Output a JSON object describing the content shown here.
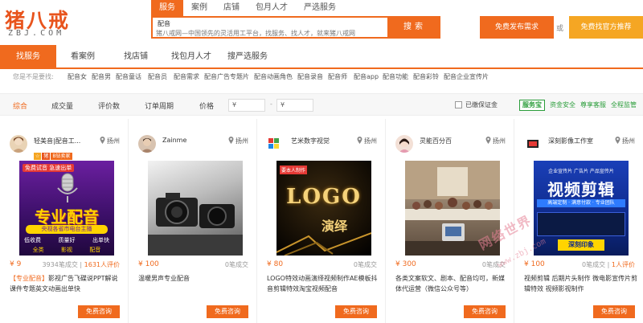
{
  "logo": {
    "cn": "猪八戒",
    "en": "ZBJ.COM"
  },
  "search": {
    "tabs": [
      "服务",
      "案例",
      "店铺",
      "包月人才",
      "严选服务"
    ],
    "query": "配音",
    "suggest": "猪八戒网—中国领先的灵活用工平台，找服务、找人才，就来猪八戒网",
    "button": "搜索"
  },
  "header_buttons": {
    "post": "免费发布需求",
    "or": "或",
    "find": "免费找官方推荐"
  },
  "nav": [
    "找服务",
    "看案例",
    "找店铺",
    "找包月人才",
    "搜严选服务"
  ],
  "related": {
    "label": "您是不是要找:",
    "items": [
      "配音女",
      "配音男",
      "配音童话",
      "配音员",
      "配音需求",
      "配音广告专题片",
      "配音动画角色",
      "配音录音",
      "配音师",
      "配音app",
      "配音功能",
      "配音彩铃",
      "配音企业宣传片"
    ]
  },
  "sortbar": {
    "items": [
      "综合",
      "成交量",
      "评价数",
      "订单周期",
      "价格"
    ],
    "price_from": "¥",
    "price_to": "¥",
    "dash": "-",
    "guarantee": "已缴保证金",
    "svc_logo": "服务宝",
    "svc_items": [
      "资金安全",
      "尊享客服",
      "全程监管"
    ]
  },
  "cards": [
    {
      "name": "轻美音|配音工...",
      "location": "扬州",
      "badges": [
        "☆",
        "猪",
        "B钻卖家"
      ],
      "price": "¥ 9",
      "stats_a": "3934笔成交",
      "stats_b": "1631人评价",
      "title_hl": "【专业配音】",
      "title": "影视广告飞碟说PPT解说课件专题英文动画出单快",
      "button": "免费咨询",
      "poster": {
        "line1": "免费试音 急速出单",
        "line2": "专业配音",
        "line3": "央视各省市电台主播",
        "tags": [
          "低收费",
          "质量好",
          "出单快",
          "全类",
          "影视",
          "配音"
        ]
      }
    },
    {
      "name": "Zainme",
      "location": "扬州",
      "badges": [],
      "price": "¥ 100",
      "stats_a": "0笔成交",
      "stats_b": "",
      "title_hl": "",
      "title": "温暖男声专业配音",
      "button": "免费咨询",
      "poster": {}
    },
    {
      "name": "艺米数字视觉",
      "location": "扬州",
      "badges": [],
      "price": "¥ 80",
      "stats_a": "0笔成交",
      "stats_b": "",
      "title_hl": "",
      "title": "LOGO特效动画演绎视频制作AE模板抖音剪辑特效淘宝视频配音",
      "button": "免费咨询",
      "poster": {
        "line1": "LOGO",
        "line2": "演绎",
        "line3": "要本人制作"
      }
    },
    {
      "name": "灵能百分百",
      "location": "扬州",
      "badges": [],
      "price": "¥ 300",
      "stats_a": "0笔成交",
      "stats_b": "",
      "title_hl": "",
      "title": "各类文案软文、剧本、配音均可，新媒体代运营（微信公众号等）",
      "button": "免费咨询",
      "poster": {}
    },
    {
      "name": "深刻影像工作室",
      "location": "扬州",
      "badges": [],
      "price": "¥ 100",
      "stats_a": "0笔成交",
      "stats_b": "1人评价",
      "title_hl": "",
      "title": "视频剪辑 后期片头制作 微电影宣传片剪辑特效 视频影视制作",
      "button": "免费咨询",
      "poster": {
        "line1": "企业宣传片 广告片 产品宣传片",
        "line2": "视频剪辑",
        "line3": "高端定制 · 满意付款 · 专业团队",
        "line4": "深刻印象"
      }
    }
  ],
  "watermark": {
    "cn": "网络世界",
    "en": "www.zbj.com"
  },
  "colors": {
    "accent": "#f06a1e",
    "gold": "#f5a623",
    "green": "#2a9d3a"
  }
}
